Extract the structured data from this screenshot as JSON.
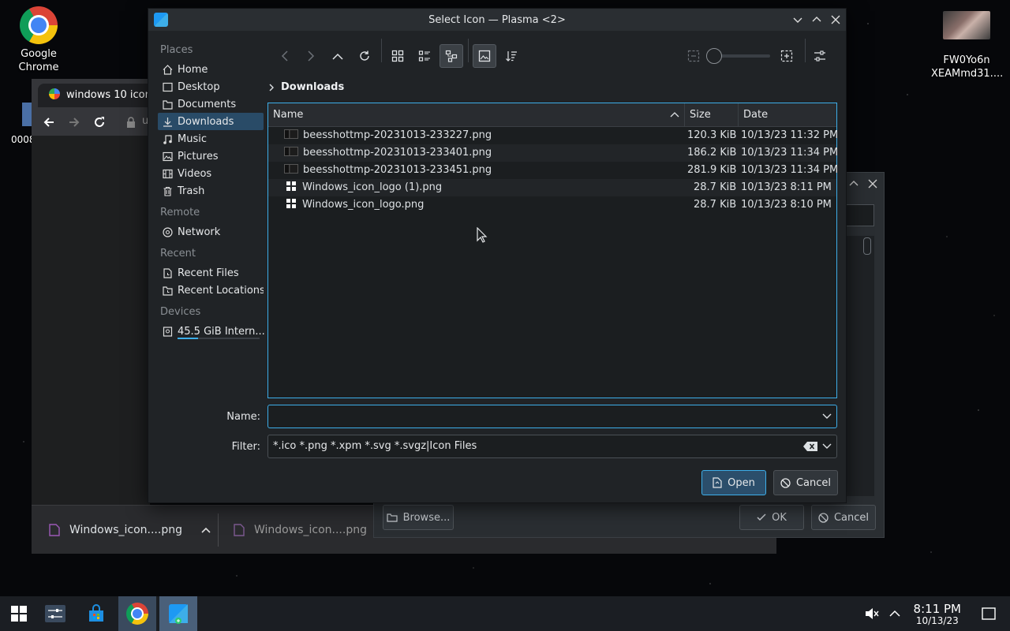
{
  "desktop": {
    "icons": [
      {
        "label_line1": "Google",
        "label_line2": "Chrome"
      },
      {
        "label_line1": "FW0Yo6n",
        "label_line2": "XEAMmd31...."
      }
    ],
    "partial_label": "0008"
  },
  "bg_browser": {
    "tab_title": "windows 10 icon",
    "address_partial": "u",
    "downloads": [
      {
        "name": "Windows_icon....png"
      },
      {
        "name": "Windows_icon....png"
      }
    ]
  },
  "bg_dialog": {
    "browse_label": "Browse...",
    "ok_label": "OK",
    "cancel_label": "Cancel"
  },
  "dialog": {
    "title": "Select Icon — Plasma <2>",
    "places": {
      "header": "Places",
      "items": [
        {
          "label": "Home",
          "icon": "home-icon"
        },
        {
          "label": "Desktop",
          "icon": "desktop-icon"
        },
        {
          "label": "Documents",
          "icon": "documents-icon"
        },
        {
          "label": "Downloads",
          "icon": "downloads-icon"
        },
        {
          "label": "Music",
          "icon": "music-icon"
        },
        {
          "label": "Pictures",
          "icon": "pictures-icon"
        },
        {
          "label": "Videos",
          "icon": "videos-icon"
        },
        {
          "label": "Trash",
          "icon": "trash-icon"
        }
      ],
      "remote_header": "Remote",
      "remote_items": [
        {
          "label": "Network",
          "icon": "network-icon"
        }
      ],
      "recent_header": "Recent",
      "recent_items": [
        {
          "label": "Recent Files",
          "icon": "recent-files-icon"
        },
        {
          "label": "Recent Locations",
          "icon": "recent-locations-icon"
        }
      ],
      "devices_header": "Devices",
      "device_items": [
        {
          "label": "45.5 GiB Intern...",
          "icon": "drive-icon",
          "usage_fraction": 0.25
        }
      ]
    },
    "breadcrumb": "Downloads",
    "columns": {
      "name": "Name",
      "size": "Size",
      "date": "Date"
    },
    "files": [
      {
        "name": "beesshottmp-20231013-233227.png",
        "size": "120.3 KiB",
        "date": "10/13/23 11:32 PM",
        "icon": "image-thumbnail"
      },
      {
        "name": "beesshottmp-20231013-233401.png",
        "size": "186.2 KiB",
        "date": "10/13/23 11:34 PM",
        "icon": "image-thumbnail"
      },
      {
        "name": "beesshottmp-20231013-233451.png",
        "size": "281.9 KiB",
        "date": "10/13/23 11:34 PM",
        "icon": "image-thumbnail"
      },
      {
        "name": "Windows_icon_logo (1).png",
        "size": "28.7 KiB",
        "date": "10/13/23 8:11 PM",
        "icon": "windows-logo"
      },
      {
        "name": "Windows_icon_logo.png",
        "size": "28.7 KiB",
        "date": "10/13/23 8:10 PM",
        "icon": "windows-logo"
      }
    ],
    "name_label": "Name:",
    "name_value": "",
    "filter_label": "Filter:",
    "filter_value": "*.ico *.png *.xpm *.svg *.svgz|Icon Files",
    "open_label": "Open",
    "cancel_label": "Cancel",
    "zoom_fraction": 0
  },
  "taskbar": {
    "time": "8:11 PM",
    "date": "10/13/23"
  },
  "colors": {
    "accent": "#3daee9",
    "selection": "#294b67"
  }
}
